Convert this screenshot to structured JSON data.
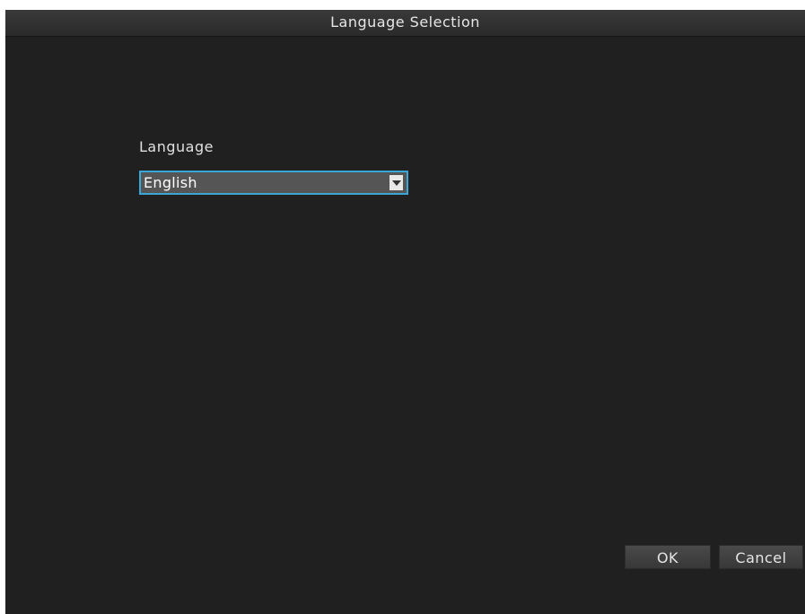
{
  "dialog": {
    "title": "Language Selection",
    "language_label": "Language",
    "language_select": {
      "selected": "English"
    },
    "ok_label": "OK",
    "cancel_label": "Cancel"
  },
  "icons": {
    "select_arrow": "chevron-down-icon"
  },
  "colors": {
    "background": "#202020",
    "select_border": "#3aa6d8",
    "select_fill": "#555555"
  }
}
